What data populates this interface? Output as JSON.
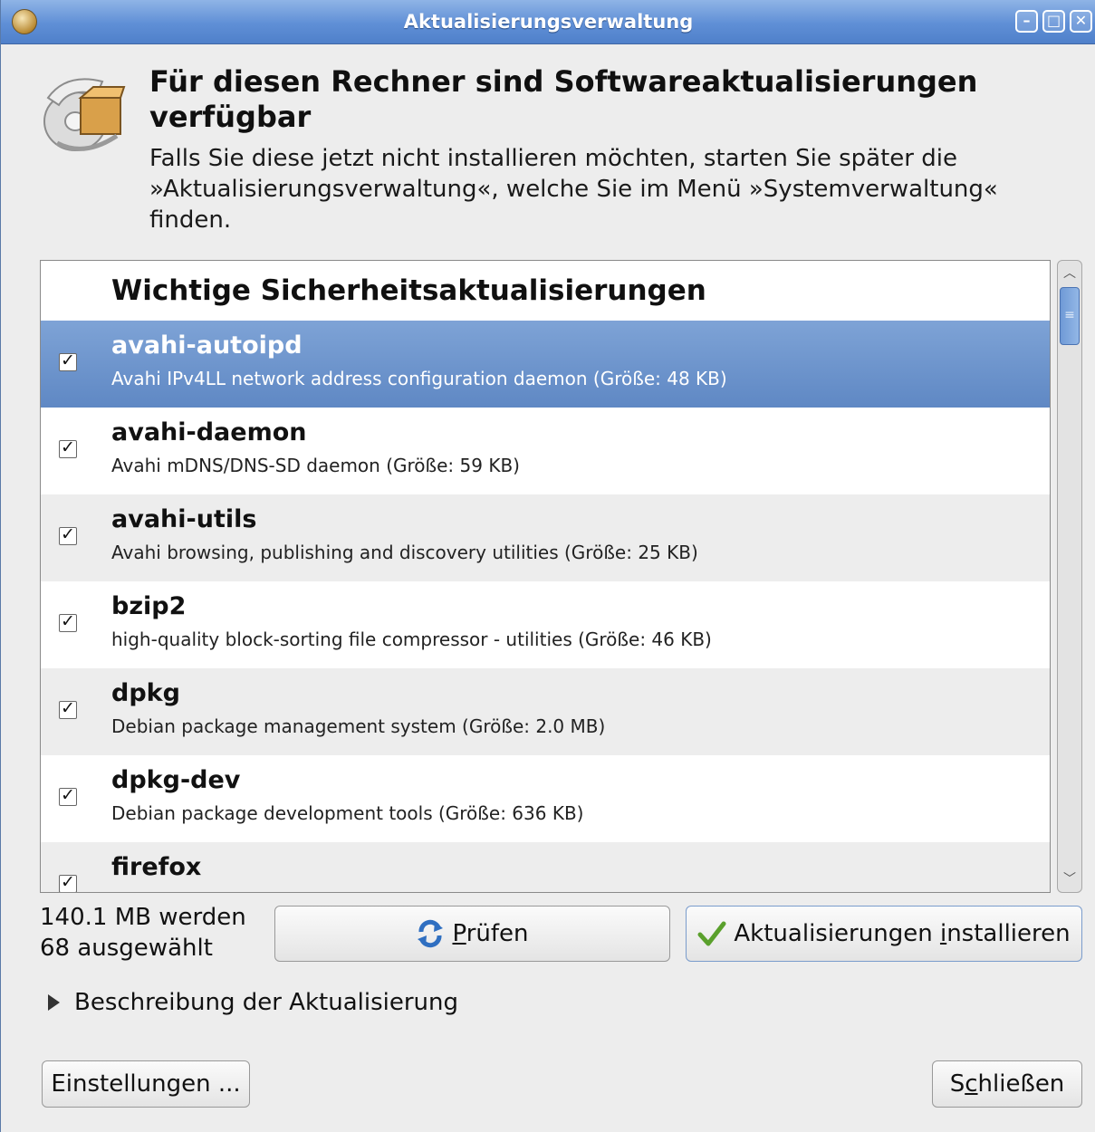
{
  "window": {
    "title": "Aktualisierungsverwaltung",
    "controls": [
      "–",
      "□",
      "✕"
    ]
  },
  "header": {
    "headline": "Für diesen Rechner sind Softwareaktualisierungen verfügbar",
    "subtext": "Falls Sie diese jetzt nicht installieren möchten, starten Sie später die »Aktualisierungsverwaltung«, welche Sie im Menü »Systemverwaltung« finden."
  },
  "updates": {
    "group_title": "Wichtige Sicherheitsaktualisierungen",
    "items": [
      {
        "name": "avahi-autoipd",
        "description": "Avahi IPv4LL network address configuration daemon (Größe: 48 KB)",
        "checked": true,
        "selected": true
      },
      {
        "name": "avahi-daemon",
        "description": "Avahi mDNS/DNS-SD daemon (Größe: 59 KB)",
        "checked": true
      },
      {
        "name": "avahi-utils",
        "description": "Avahi browsing, publishing and discovery utilities (Größe: 25 KB)",
        "checked": true
      },
      {
        "name": "bzip2",
        "description": "high-quality block-sorting file compressor - utilities (Größe: 46 KB)",
        "checked": true
      },
      {
        "name": "dpkg",
        "description": "Debian package management system (Größe: 2.0 MB)",
        "checked": true
      },
      {
        "name": "dpkg-dev",
        "description": "Debian package development tools (Größe: 636 KB)",
        "checked": true
      },
      {
        "name": "firefox",
        "description": "",
        "checked": true
      }
    ]
  },
  "summary": {
    "line1": "140.1 MB werden",
    "line2": "68 ausgewählt"
  },
  "buttons": {
    "check_pre": "",
    "check_ul": "P",
    "check_post": "rüfen",
    "install_pre": "Aktualisierungen ",
    "install_ul": "i",
    "install_post": "nstallieren",
    "settings": "Einstellungen ...",
    "close_pre": "S",
    "close_ul": "c",
    "close_post": "hließen"
  },
  "expander": {
    "label": "Beschreibung der Aktualisierung"
  },
  "colors": {
    "titlebar": "#5f8fd6",
    "selection": "#6f96cd",
    "window_bg": "#ededed"
  }
}
